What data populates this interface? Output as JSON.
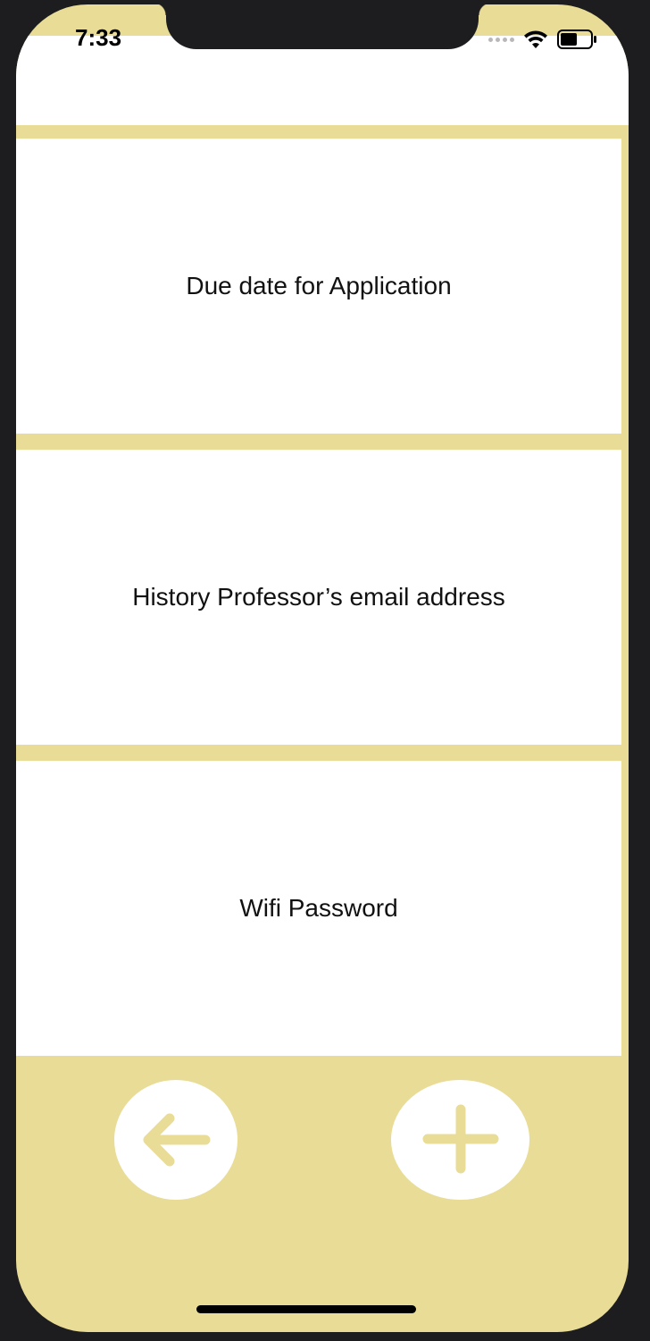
{
  "status_bar": {
    "time": "7:33",
    "icons": [
      "signal-icon",
      "wifi-icon",
      "battery-icon"
    ]
  },
  "notes": [
    {
      "label": "Due date for Application"
    },
    {
      "label": "History Professor’s email address"
    },
    {
      "label": "Wifi Password"
    }
  ],
  "toolbar": {
    "back_icon": "arrow-left-icon",
    "add_icon": "plus-icon"
  },
  "colors": {
    "accent": "#e8dc97",
    "card": "#ffffff",
    "frame": "#1d1d1f",
    "text": "#111111"
  }
}
